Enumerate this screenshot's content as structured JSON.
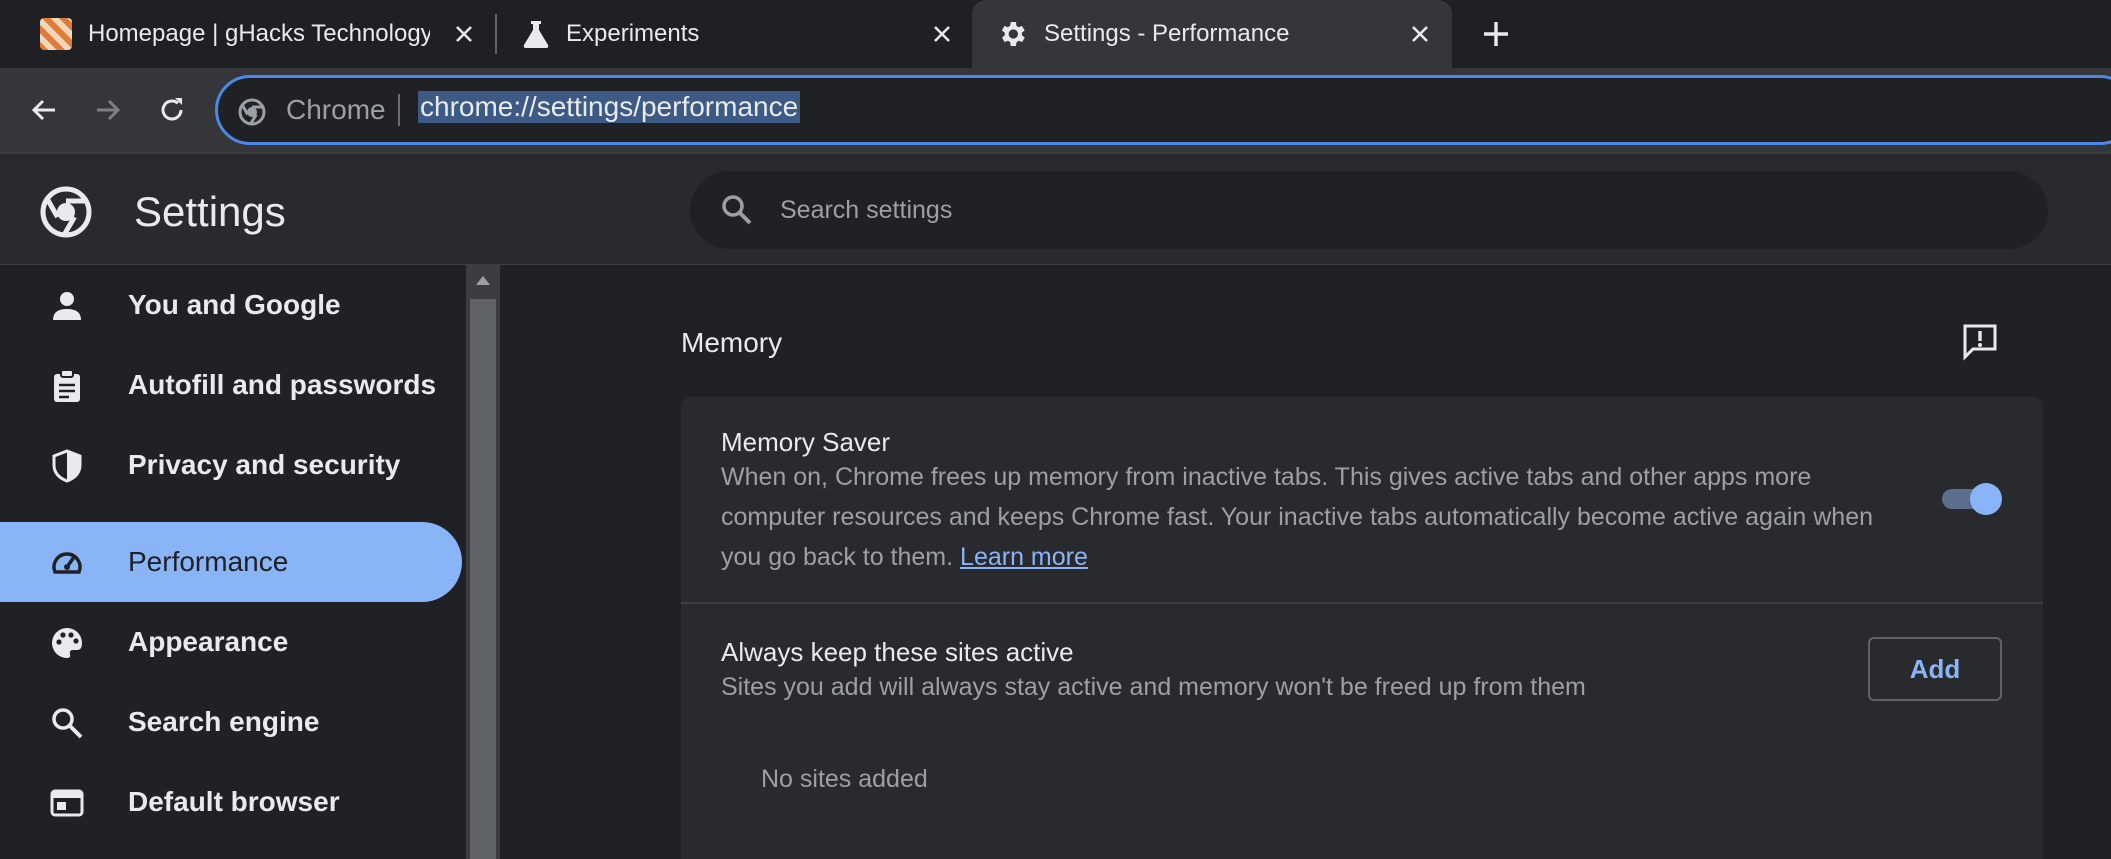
{
  "tabs": [
    {
      "title": "Homepage | gHacks Technology News",
      "favicon": "ghacks-favicon"
    },
    {
      "title": "Experiments",
      "favicon": "flask-icon"
    },
    {
      "title": "Settings - Performance",
      "favicon": "gear-icon",
      "active": true
    }
  ],
  "omnibox": {
    "chip": "Chrome",
    "url": "chrome://settings/performance"
  },
  "header": {
    "title": "Settings",
    "search_placeholder": "Search settings"
  },
  "sidebar": {
    "items": [
      {
        "label": "You and Google",
        "icon": "person-icon"
      },
      {
        "label": "Autofill and passwords",
        "icon": "clipboard-icon"
      },
      {
        "label": "Privacy and security",
        "icon": "shield-icon"
      },
      {
        "label": "Performance",
        "icon": "speedometer-icon",
        "active": true
      },
      {
        "label": "Appearance",
        "icon": "palette-icon"
      },
      {
        "label": "Search engine",
        "icon": "search-icon"
      },
      {
        "label": "Default browser",
        "icon": "browser-window-icon"
      }
    ]
  },
  "main": {
    "section_title": "Memory",
    "memory_saver": {
      "title": "Memory Saver",
      "description": "When on, Chrome frees up memory from inactive tabs. This gives active tabs and other apps more computer resources and keeps Chrome fast. Your inactive tabs automatically become active again when you go back to them.",
      "learn_more": "Learn more",
      "enabled": true
    },
    "keep_active": {
      "title": "Always keep these sites active",
      "description": "Sites you add will always stay active and memory won't be freed up from them",
      "add_label": "Add",
      "empty_text": "No sites added"
    }
  },
  "colors": {
    "accent": "#8ab4f8",
    "background": "#202124",
    "card": "#292a2d",
    "omnibox_border": "#4d88e8"
  }
}
